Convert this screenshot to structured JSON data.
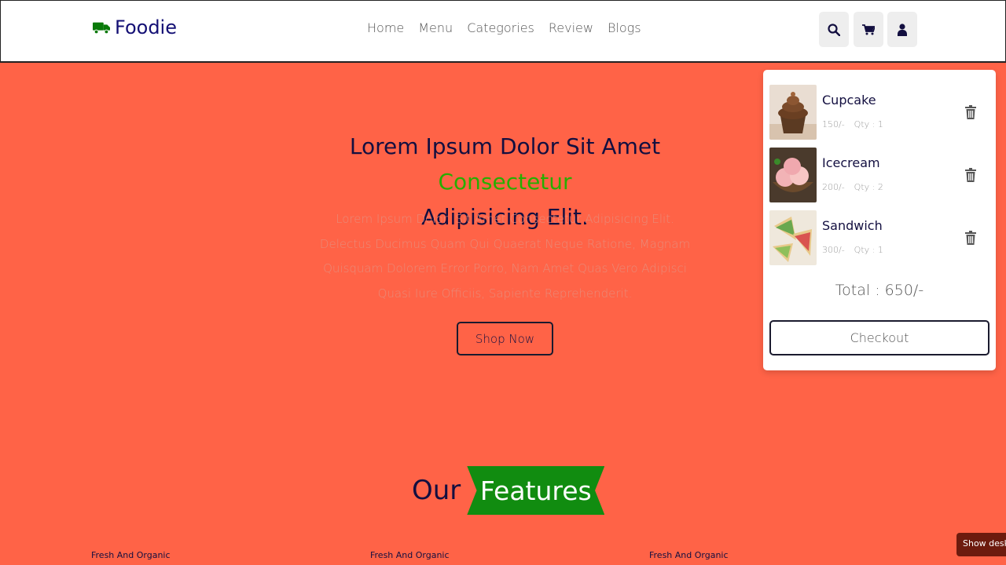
{
  "header": {
    "logo": "Foodie",
    "nav": [
      "Home",
      "Menu",
      "Categories",
      "Review",
      "Blogs"
    ]
  },
  "hero": {
    "title_main": "Lorem Ipsum Dolor Sit Amet",
    "title_accent": "Consectetur",
    "title_end": "Adipisicing Elit.",
    "text": "Lorem Ipsum Dolor, Sit Amet Consectetur Adipisicing Elit. Delectus Ducimus Quam Qui Quaerat Neque Ratione, Magnam Quisquam Dolorem Error Porro, Nam Amet Quas Vero Adipisci Quasi Iure Officiis, Sapiente Reprehenderit.",
    "button": "Shop Now"
  },
  "cart": {
    "items": [
      {
        "name": "Cupcake",
        "price": "150/-",
        "qty": "Qty : 1"
      },
      {
        "name": "Icecream",
        "price": "200/-",
        "qty": "Qty : 2"
      },
      {
        "name": "Sandwich",
        "price": "300/-",
        "qty": "Qty : 1"
      }
    ],
    "total": "Total : 650/-",
    "checkout": "Checkout"
  },
  "features": {
    "heading_plain": "Our",
    "heading_highlight": "Features",
    "labels": [
      "Fresh And Organic",
      "Fresh And Organic",
      "Fresh And Organic"
    ]
  },
  "toast": "Show desktop",
  "colors": {
    "background": "#ff6347",
    "accent_green": "#27ae00",
    "ribbon_green": "#118c10",
    "dark": "#130f40"
  }
}
